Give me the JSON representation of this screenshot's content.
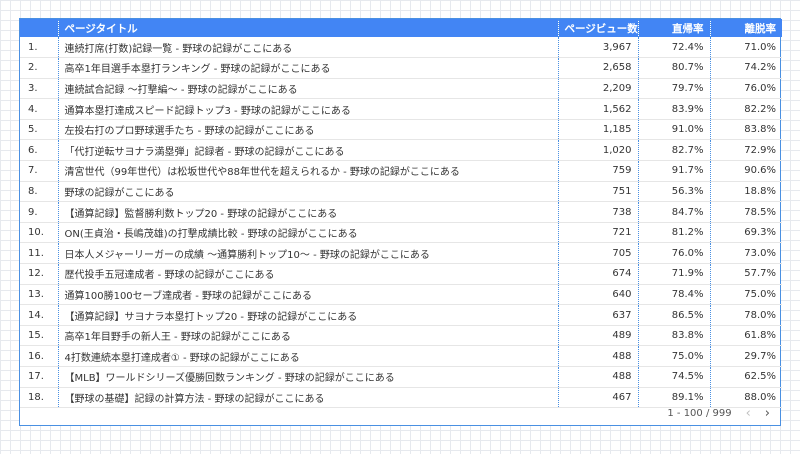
{
  "table": {
    "headers": {
      "title": "ページタイトル",
      "pageviews": "ページビュー数",
      "sort_indicator": "↓",
      "return_rate": "直帰率",
      "exit_rate": "離脱率"
    },
    "rows": [
      {
        "idx": "1.",
        "title": "連続打席(打数)記録一覧 - 野球の記録がここにある",
        "pv": "3,967",
        "bounce": "72.4%",
        "exit": "71.0%"
      },
      {
        "idx": "2.",
        "title": "高卒1年目選手本塁打ランキング - 野球の記録がここにある",
        "pv": "2,658",
        "bounce": "80.7%",
        "exit": "74.2%"
      },
      {
        "idx": "3.",
        "title": "連続試合記録 ～打撃編～ - 野球の記録がここにある",
        "pv": "2,209",
        "bounce": "79.7%",
        "exit": "76.0%"
      },
      {
        "idx": "4.",
        "title": "通算本塁打達成スピード記録トップ3 - 野球の記録がここにある",
        "pv": "1,562",
        "bounce": "83.9%",
        "exit": "82.2%"
      },
      {
        "idx": "5.",
        "title": "左投右打のプロ野球選手たち - 野球の記録がここにある",
        "pv": "1,185",
        "bounce": "91.0%",
        "exit": "83.8%"
      },
      {
        "idx": "6.",
        "title": "「代打逆転サヨナラ満塁弾」記録者 - 野球の記録がここにある",
        "pv": "1,020",
        "bounce": "82.7%",
        "exit": "72.9%"
      },
      {
        "idx": "7.",
        "title": "清宮世代（99年世代）は松坂世代や88年世代を超えられるか - 野球の記録がここにある",
        "pv": "759",
        "bounce": "91.7%",
        "exit": "90.6%"
      },
      {
        "idx": "8.",
        "title": "野球の記録がここにある",
        "pv": "751",
        "bounce": "56.3%",
        "exit": "18.8%"
      },
      {
        "idx": "9.",
        "title": "【通算記録】監督勝利数トップ20 - 野球の記録がここにある",
        "pv": "738",
        "bounce": "84.7%",
        "exit": "78.5%"
      },
      {
        "idx": "10.",
        "title": "ON(王貞治・長嶋茂雄)の打撃成績比較 - 野球の記録がここにある",
        "pv": "721",
        "bounce": "81.2%",
        "exit": "69.3%"
      },
      {
        "idx": "11.",
        "title": "日本人メジャーリーガーの成績 ～通算勝利トップ10～ - 野球の記録がここにある",
        "pv": "705",
        "bounce": "76.0%",
        "exit": "73.0%"
      },
      {
        "idx": "12.",
        "title": "歴代投手五冠達成者 - 野球の記録がここにある",
        "pv": "674",
        "bounce": "71.9%",
        "exit": "57.7%"
      },
      {
        "idx": "13.",
        "title": "通算100勝100セーブ達成者 - 野球の記録がここにある",
        "pv": "640",
        "bounce": "78.4%",
        "exit": "75.0%"
      },
      {
        "idx": "14.",
        "title": "【通算記録】サヨナラ本塁打トップ20 - 野球の記録がここにある",
        "pv": "637",
        "bounce": "86.5%",
        "exit": "78.0%"
      },
      {
        "idx": "15.",
        "title": "高卒1年目野手の新人王 - 野球の記録がここにある",
        "pv": "489",
        "bounce": "83.8%",
        "exit": "61.8%"
      },
      {
        "idx": "16.",
        "title": "4打数連続本塁打達成者① - 野球の記録がここにある",
        "pv": "488",
        "bounce": "75.0%",
        "exit": "29.7%"
      },
      {
        "idx": "17.",
        "title": "【MLB】ワールドシリーズ優勝回数ランキング - 野球の記録がここにある",
        "pv": "488",
        "bounce": "74.5%",
        "exit": "62.5%"
      },
      {
        "idx": "18.",
        "title": "【野球の基礎】記録の計算方法 - 野球の記録がここにある",
        "pv": "467",
        "bounce": "89.1%",
        "exit": "88.0%"
      }
    ]
  },
  "pagination": {
    "range_text": "1 - 100 / 999",
    "prev_icon": "‹",
    "next_icon": "›"
  },
  "colors": {
    "header_bg": "#4285f4",
    "border": "#4a90e2"
  }
}
